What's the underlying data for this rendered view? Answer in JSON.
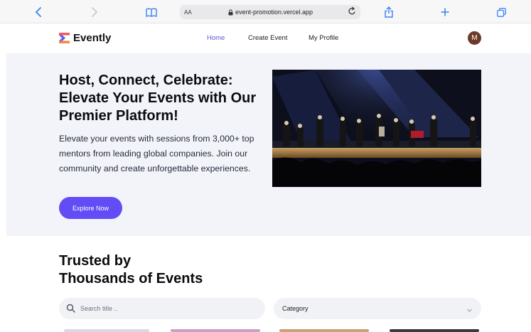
{
  "browser": {
    "aa_label": "AA",
    "url": "event-promotion.vercel.app"
  },
  "nav": {
    "brand": "Evently",
    "links": [
      "Home",
      "Create Event",
      "My Profile"
    ],
    "avatar_initial": "M",
    "accent": "#5b5bd6"
  },
  "hero": {
    "title": "Host, Connect, Celebrate: Elevate Your Events with Our Premier Platform!",
    "description": "Elevate your events with sessions from 3,000+ top mentors from leading global companies. Join our community and create unforgettable experiences.",
    "cta_label": "Explore Now",
    "cta_color": "#624cf5"
  },
  "section": {
    "heading_line1": "Trusted by",
    "heading_line2": "Thousands of Events"
  },
  "filters": {
    "search_placeholder": "Search title ..",
    "category_label": "Category"
  }
}
